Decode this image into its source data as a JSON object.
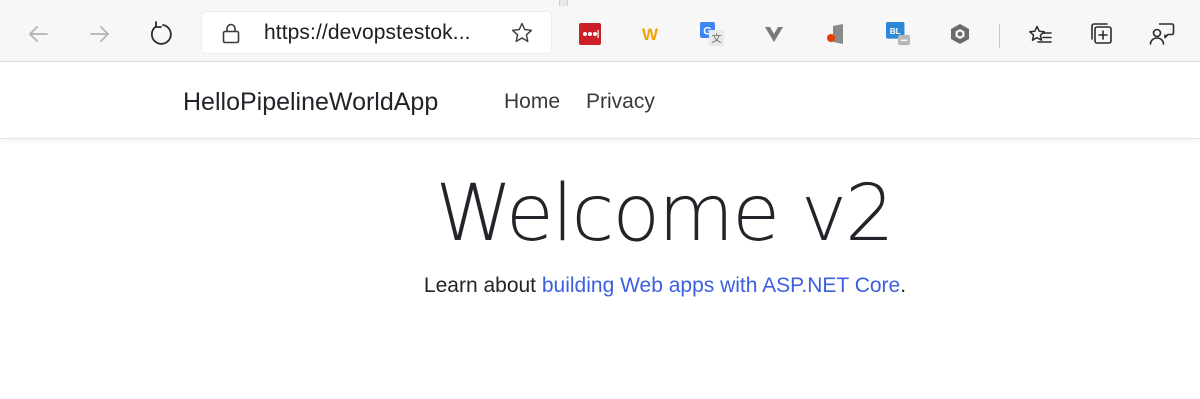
{
  "browser": {
    "address_bar": {
      "url": "https://devopstestok..."
    },
    "icons": {
      "back": "back-arrow-icon",
      "forward": "forward-arrow-icon",
      "refresh": "refresh-icon",
      "lock": "lock-icon",
      "favorite": "star-icon",
      "favorites_bar": "favorites-list-icon",
      "collections": "collections-icon",
      "feedback": "feedback-icon"
    },
    "extensions": [
      {
        "name": "lastpass-extension-icon",
        "color": "#cc2029"
      },
      {
        "name": "w-extension-icon",
        "color": "#f0a30a",
        "letter": "W"
      },
      {
        "name": "google-translate-extension-icon",
        "color": "#4285f4"
      },
      {
        "name": "v-extension-icon",
        "color": "#7a7a7a"
      },
      {
        "name": "office-extension-icon",
        "color": "#eb3c00"
      },
      {
        "name": "bl-extension-icon",
        "color": "#2b88d8",
        "letter": "BL"
      },
      {
        "name": "hexagon-extension-icon",
        "color": "#6b6b6b"
      }
    ]
  },
  "navbar": {
    "brand": "HelloPipelineWorldApp",
    "links": [
      "Home",
      "Privacy"
    ]
  },
  "main": {
    "heading": "Welcome v2",
    "lead_prefix": "Learn about ",
    "lead_link": "building Web apps with ASP.NET Core",
    "lead_suffix": "."
  },
  "colors": {
    "link": "#3b5fe0",
    "text": "#212529"
  }
}
